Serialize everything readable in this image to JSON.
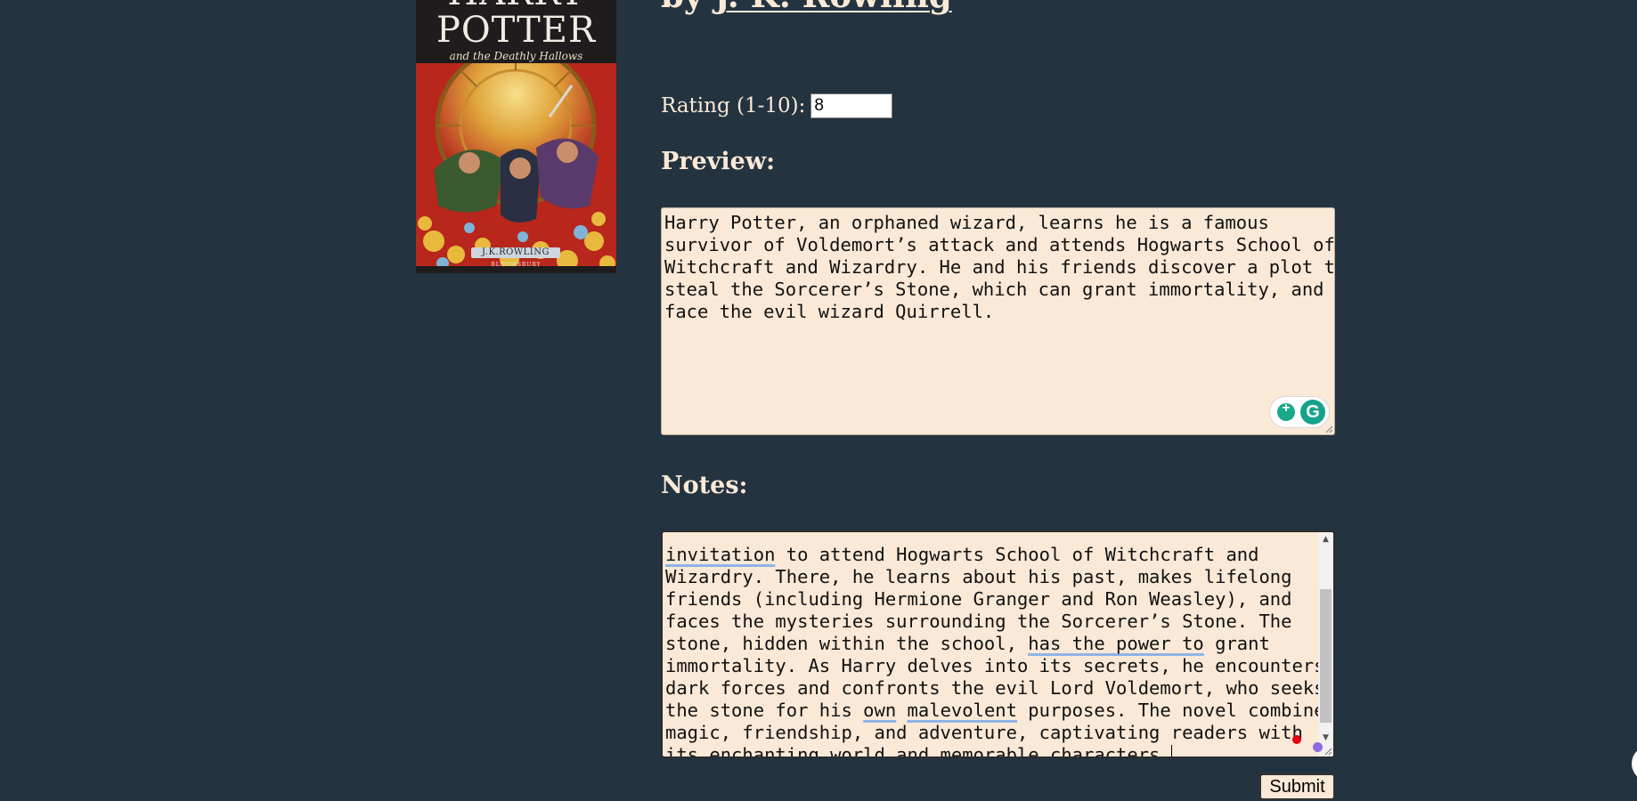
{
  "book": {
    "cover": {
      "title_line1": "HARRY",
      "title_line2": "POTTER",
      "subtitle": "and the Deathly Hallows",
      "author": "J.K.ROWLING",
      "publisher": "BLOOMSBURY"
    },
    "heading_prefix": "by ",
    "author": "J. K. Rowling"
  },
  "rating": {
    "label": "Rating (1-10):",
    "value": "8"
  },
  "preview": {
    "heading": "Preview:",
    "lines": [
      "Harry Potter, an orphaned wizard, learns he is a famous",
      "survivor of Voldemort’s attack and attends Hogwarts School of",
      "Witchcraft and Wizardry. He and his friends discover a plot to",
      "steal the Sorcerer’s Stone, which can grant immortality, and",
      "face the evil wizard Quirrell."
    ]
  },
  "notes": {
    "heading": "Notes:",
    "line1_a": "invitation",
    "line1_b": " to attend Hogwarts School of Witchcraft and",
    "line2": "Wizardry. There, he learns about his past, makes lifelong",
    "line3": "friends (including Hermione Granger and Ron Weasley), and",
    "line4": "faces the mysteries surrounding the Sorcerer’s Stone. The",
    "line5_a": "stone, hidden within the school, ",
    "line5_b": "has the power to",
    "line5_c": " grant",
    "line6": "immortality. As Harry delves into its secrets, he encounters",
    "line7": "dark forces and confronts the evil Lord Voldemort, who seeks",
    "line8_a": "the stone for his ",
    "line8_b": "own",
    "line8_c": " ",
    "line8_d": "malevolent",
    "line8_e": " purposes. The novel combines",
    "line9": "magic, friendship, and adventure, captivating readers with",
    "line10": "its enchanting world and memorable characters."
  },
  "submit": {
    "label": "Submit"
  },
  "colors": {
    "background": "#243340",
    "text": "#f9e9d6",
    "textarea_bg": "#fae9d6",
    "grammarly": "#15a38d",
    "squiggle": "#8fb3e6"
  }
}
